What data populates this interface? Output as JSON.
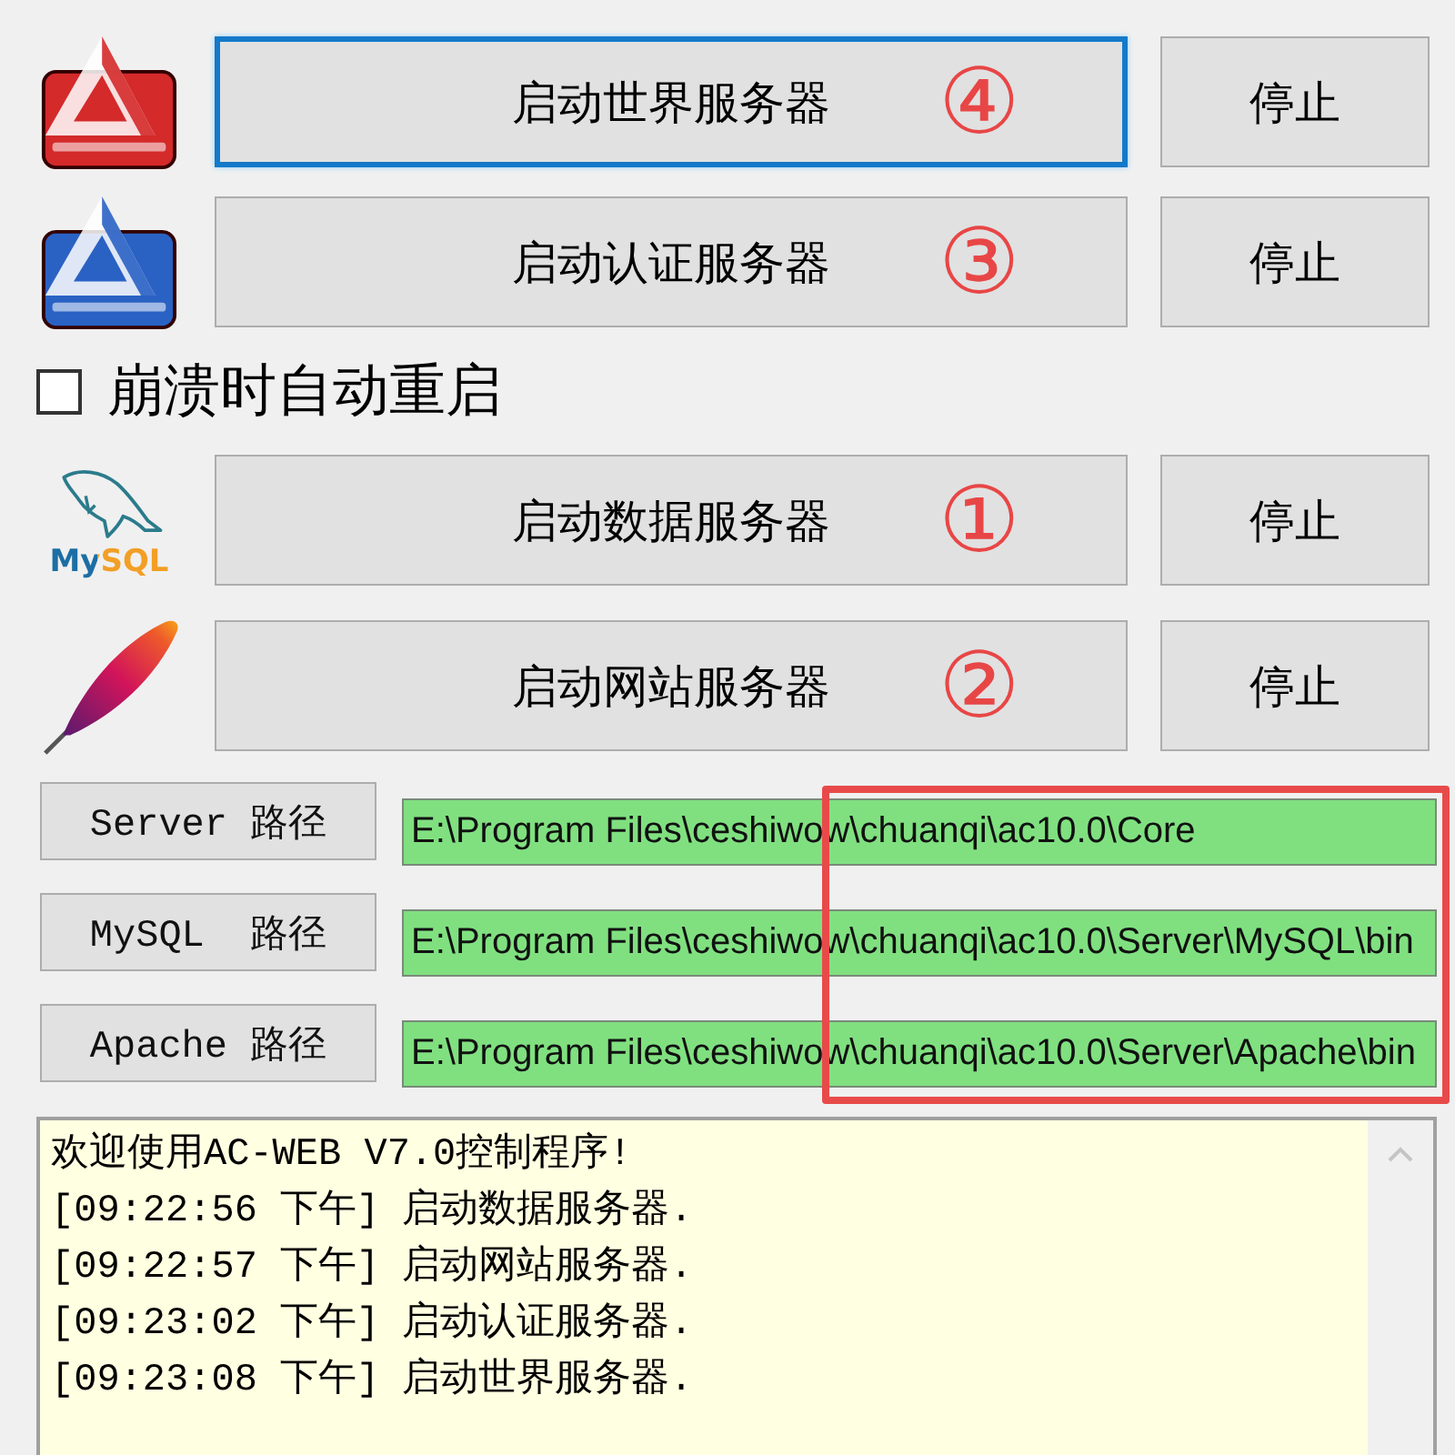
{
  "controls": [
    {
      "kind": "server",
      "logo": {
        "kind": "triangle",
        "color": "#d42a2a"
      },
      "start_label": "启动世界服务器",
      "start_focused": true,
      "order_mark": "④",
      "stop_label": "停止"
    },
    {
      "kind": "server",
      "logo": {
        "kind": "triangle",
        "color": "#2a62c4"
      },
      "start_label": "启动认证服务器",
      "start_focused": false,
      "order_mark": "③",
      "stop_label": "停止"
    },
    {
      "kind": "checkbox",
      "label": "崩溃时自动重启",
      "checked": false
    },
    {
      "kind": "server",
      "logo": {
        "kind": "dolphin",
        "text": "MySQL"
      },
      "start_label": "启动数据服务器",
      "start_focused": false,
      "order_mark": "①",
      "stop_label": "停止"
    },
    {
      "kind": "server",
      "logo": {
        "kind": "feather"
      },
      "start_label": "启动网站服务器",
      "start_focused": false,
      "order_mark": "②",
      "stop_label": "停止"
    }
  ],
  "paths": {
    "highlighted": true,
    "rows": [
      {
        "label": "Server 路径",
        "value": "E:\\Program Files\\ceshiwow\\chuanqi\\ac10.0\\Core"
      },
      {
        "label": "MySQL  路径",
        "value": "E:\\Program Files\\ceshiwow\\chuanqi\\ac10.0\\Server\\MySQL\\bin"
      },
      {
        "label": "Apache 路径",
        "value": "E:\\Program Files\\ceshiwow\\chuanqi\\ac10.0\\Server\\Apache\\bin"
      }
    ]
  },
  "log": {
    "lines": [
      "欢迎使用AC-WEB V7.0控制程序!",
      "[09:22:56 下午] 启动数据服务器.",
      "[09:22:57 下午] 启动网站服务器.",
      "[09:23:02 下午] 启动认证服务器.",
      "[09:23:08 下午] 启动世界服务器."
    ]
  }
}
